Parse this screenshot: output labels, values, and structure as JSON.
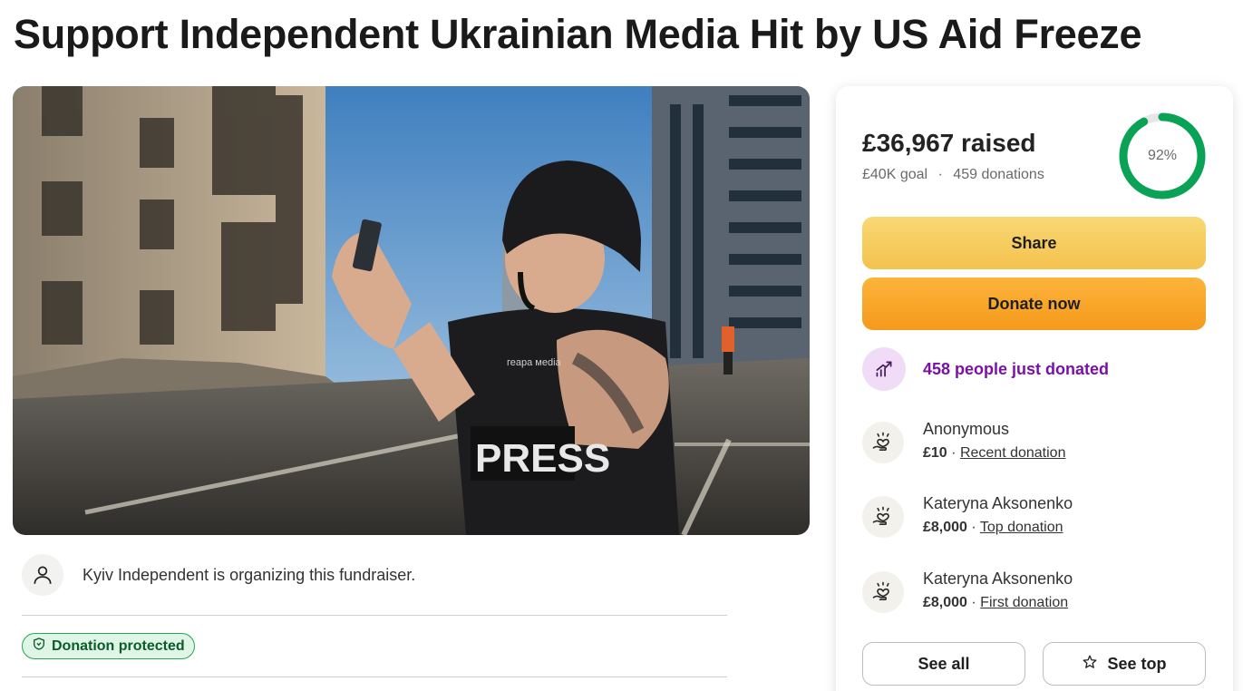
{
  "page": {
    "title": "Support Independent Ukrainian Media Hit by US Aid Freeze"
  },
  "hero": {
    "vest_label": "PRESS",
    "vest_brand": "геара меdia"
  },
  "organizer": {
    "text": "Kyiv Independent is organizing this fundraiser."
  },
  "badge": {
    "label": "Donation protected"
  },
  "progress": {
    "raised": "£36,967 raised",
    "goal": "£40K goal",
    "separator": "·",
    "donations": "459 donations",
    "percent_label": "92%",
    "percent_value": 0.92,
    "ring_color": "#0aa355",
    "track_color": "#e6e6e6"
  },
  "buttons": {
    "share": "Share",
    "donate": "Donate now",
    "see_all": "See all",
    "see_top": "See top"
  },
  "activity": {
    "text": "458 people just donated",
    "color": "#7a10a8"
  },
  "donors": [
    {
      "name": "Anonymous",
      "amount": "£10",
      "sep": "·",
      "tag": "Recent donation"
    },
    {
      "name": "Kateryna Aksonenko",
      "amount": "£8,000",
      "sep": "·",
      "tag": "Top donation"
    },
    {
      "name": "Kateryna Aksonenko",
      "amount": "£8,000",
      "sep": "·",
      "tag": "First donation"
    }
  ],
  "icons": {
    "organizer": "user-icon",
    "badge": "shield-icon",
    "activity": "trending-up-icon",
    "donor": "heart-hand-icon",
    "see_top": "star-icon"
  }
}
